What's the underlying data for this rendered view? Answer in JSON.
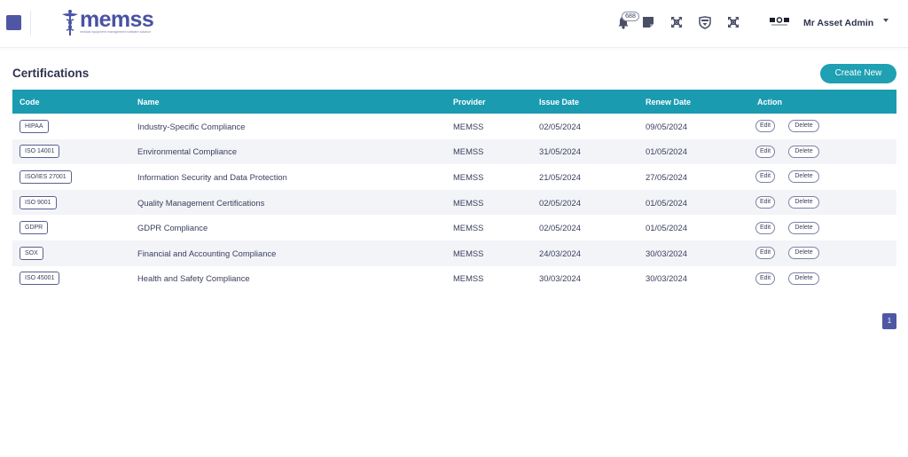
{
  "header": {
    "logo_text": "memss",
    "logo_tagline": "medical equipment management software solution",
    "notification_count": "688",
    "user_name": "Mr Asset Admin"
  },
  "page": {
    "title": "Certifications",
    "create_button": "Create New"
  },
  "table": {
    "columns": [
      "Code",
      "Name",
      "Provider",
      "Issue Date",
      "Renew Date",
      "Action"
    ],
    "rows": [
      {
        "code": "HIPAA",
        "name": "Industry-Specific Compliance",
        "provider": "MEMSS",
        "issue": "02/05/2024",
        "renew": "09/05/2024"
      },
      {
        "code": "ISO 14001",
        "name": "Environmental Compliance",
        "provider": "MEMSS",
        "issue": "31/05/2024",
        "renew": "01/05/2024"
      },
      {
        "code": "ISO/IES 27001",
        "name": "Information Security and Data Protection",
        "provider": "MEMSS",
        "issue": "21/05/2024",
        "renew": "27/05/2024"
      },
      {
        "code": "ISO 9001",
        "name": "Quality Management Certifications",
        "provider": "MEMSS",
        "issue": "02/05/2024",
        "renew": "01/05/2024"
      },
      {
        "code": "GDPR",
        "name": "GDPR Compliance",
        "provider": "MEMSS",
        "issue": "02/05/2024",
        "renew": "01/05/2024"
      },
      {
        "code": "SOX",
        "name": "Financial and Accounting Compliance",
        "provider": "MEMSS",
        "issue": "24/03/2024",
        "renew": "30/03/2024"
      },
      {
        "code": "ISO 45001",
        "name": "Health and Safety Compliance",
        "provider": "MEMSS",
        "issue": "30/03/2024",
        "renew": "30/03/2024"
      }
    ],
    "edit_label": "Edit",
    "delete_label": "Delete"
  },
  "pagination": {
    "current_page": "1"
  },
  "colors": {
    "brand": "#4f57a5",
    "table_header": "#1a9bb0",
    "create_button": "#1fa0b3"
  },
  "icons": [
    "menu-icon",
    "bell-icon",
    "sticky-note-icon",
    "expand-icon",
    "shield-icon",
    "fullscreen-icon",
    "avatar-logo"
  ]
}
